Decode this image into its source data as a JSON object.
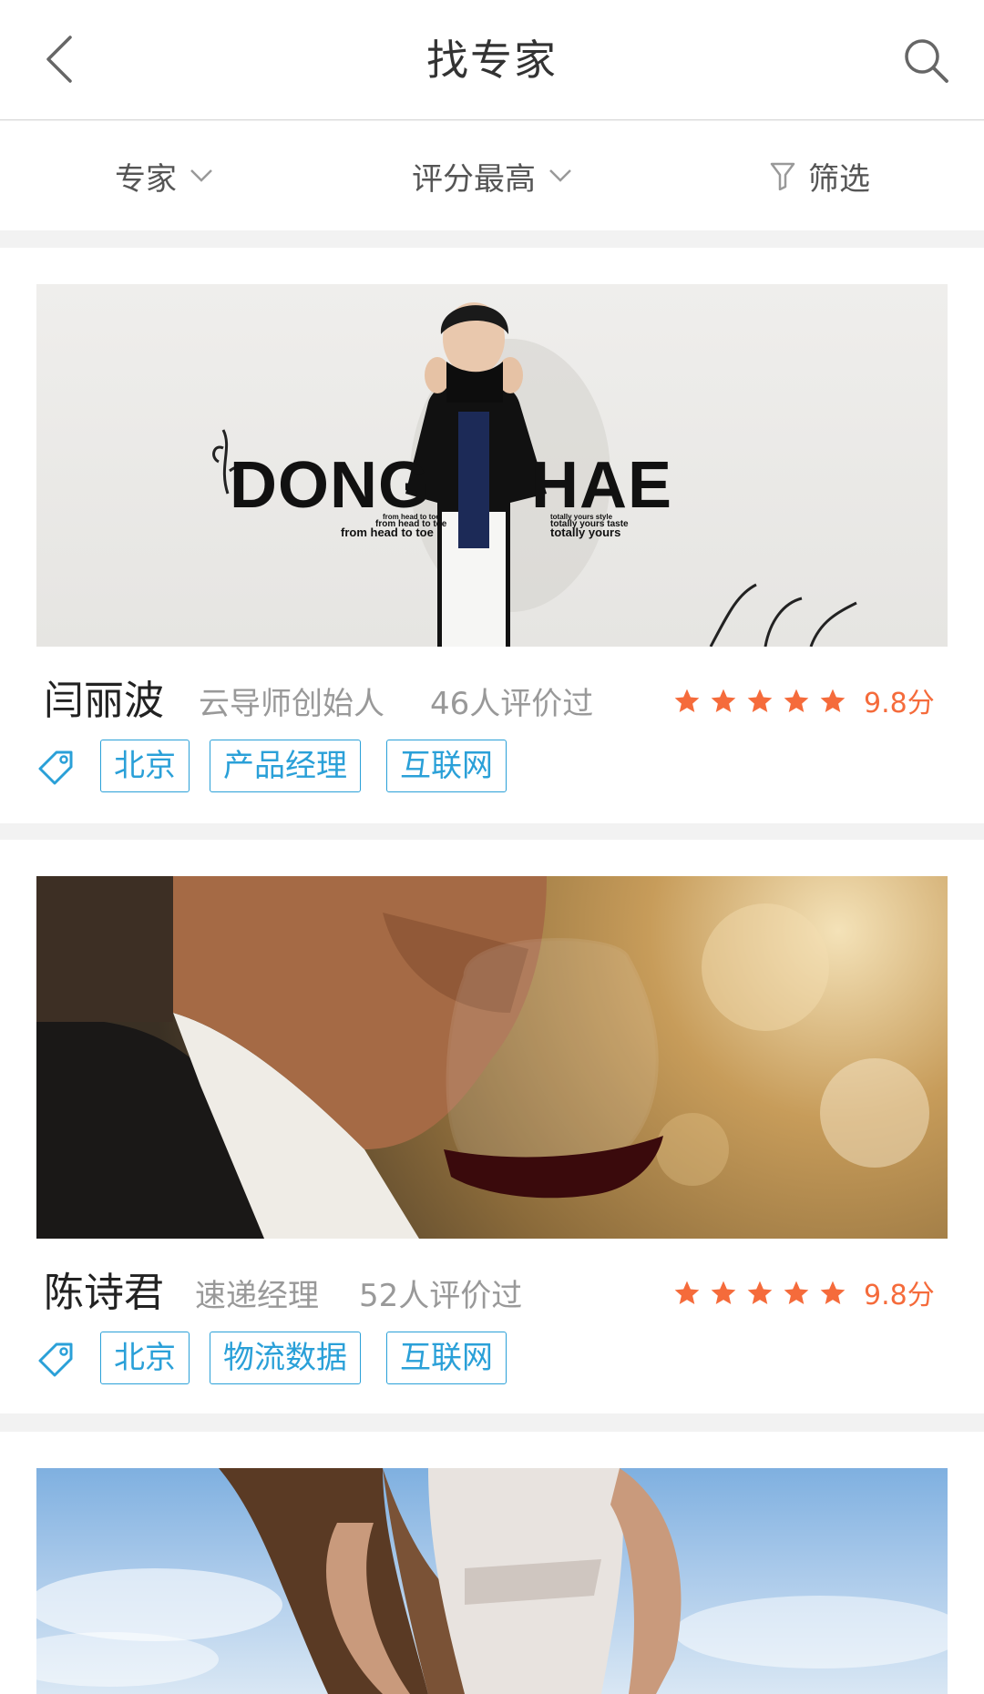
{
  "header": {
    "title": "找专家"
  },
  "filters": [
    {
      "label": "专家"
    },
    {
      "label": "评分最高"
    },
    {
      "label": "筛选"
    }
  ],
  "experts": [
    {
      "name": "闫丽波",
      "role": "云导师创始人",
      "reviews": "46人评价过",
      "rating_stars": 5,
      "score": "9.8分",
      "tags": [
        "北京",
        "产品经理",
        "互联网"
      ],
      "photo": {
        "banner_text": "DONG HAE",
        "small_left": [
          "from head to toe",
          "from head to toe",
          "from head to toe"
        ],
        "small_right": [
          "totally yours style",
          "totally yours taste",
          "totally yours"
        ]
      }
    },
    {
      "name": "陈诗君",
      "role": "速递经理",
      "reviews": "52人评价过",
      "rating_stars": 5,
      "score": "9.8分",
      "tags": [
        "北京",
        "物流数据",
        "互联网"
      ]
    }
  ],
  "colors": {
    "accent": "#2aa0d8",
    "star": "#f56b3b",
    "score": "#f56b3b"
  }
}
